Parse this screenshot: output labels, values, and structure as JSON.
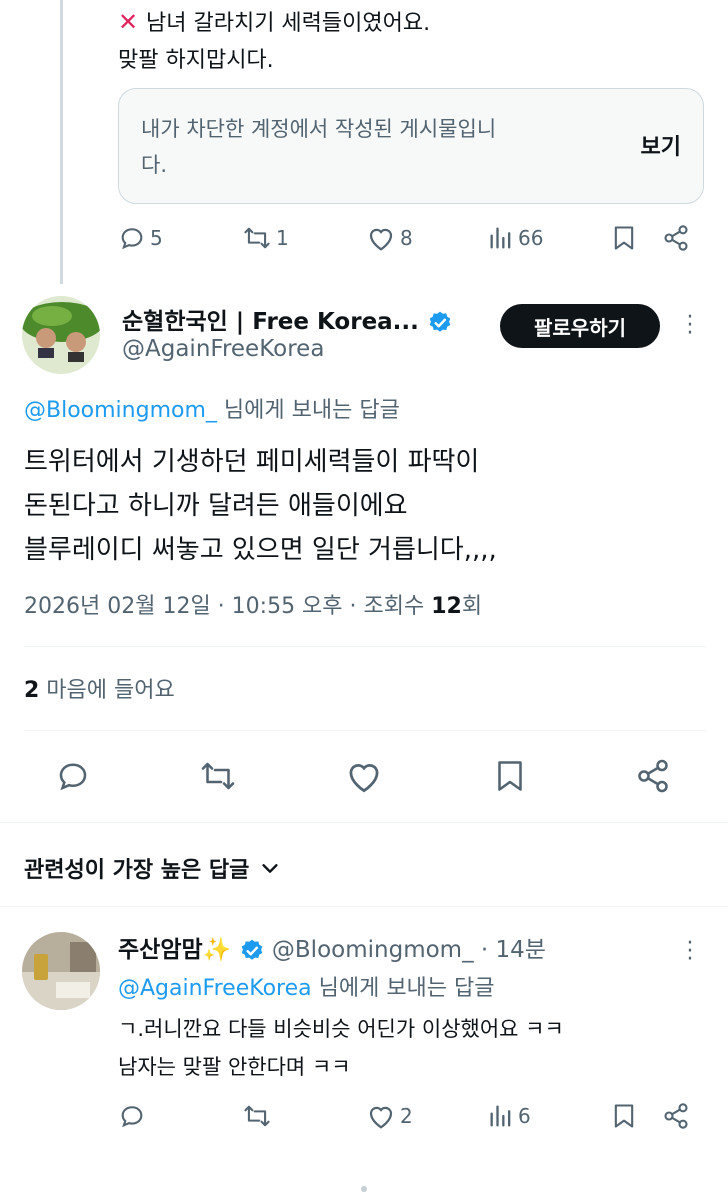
{
  "prev_post": {
    "line1": "남녀 갈라치기 세력들이였어요.",
    "line2": "맞팔 하지맙시다.",
    "blocked_notice": "내가 차단한 계정에서 작성된 게시물입니다.",
    "view_label": "보기",
    "actions": {
      "replies": "5",
      "reposts": "1",
      "likes": "8",
      "views": "66"
    }
  },
  "main_post": {
    "author_name": "순혈한국인 | Free Korea...",
    "author_handle": "@AgainFreeKorea",
    "follow_label": "팔로우하기",
    "reply_to_handle": "@Bloomingmom_",
    "reply_to_suffix": " 님에게 보내는 답글",
    "text_line1": "트위터에서 기생하던 페미세력들이 파딱이",
    "text_line2": "돈된다고 하니까 달려든 애들이에요",
    "text_line3": "블루레이디 써놓고 있으면 일단 거릅니다,,,,",
    "date_time": "2026년 02월 12일 · 10:55 오후 · 조회수 ",
    "view_count": "12",
    "view_unit": "회",
    "likes_count": "2",
    "likes_label": " 마음에 들어요"
  },
  "sort": {
    "label": "관련성이 가장 높은 답글"
  },
  "reply": {
    "author_name": "주산암맘✨",
    "author_handle": "@Bloomingmom_",
    "time": " · 14분",
    "reply_to_handle": "@AgainFreeKorea",
    "reply_to_suffix": " 님에게 보내는 답글",
    "text_line1": "ㄱ.러니깐요 다들 비슷비슷 어딘가 이상했어요 ㅋㅋ",
    "text_line2": "남자는 맞팔 안한다며 ㅋㅋ",
    "actions": {
      "replies": "",
      "reposts": "",
      "likes": "2",
      "views": "6"
    }
  },
  "colors": {
    "accent": "#1d9bf0",
    "text": "#0f1419",
    "muted": "#536471",
    "border": "#cfd9de"
  }
}
